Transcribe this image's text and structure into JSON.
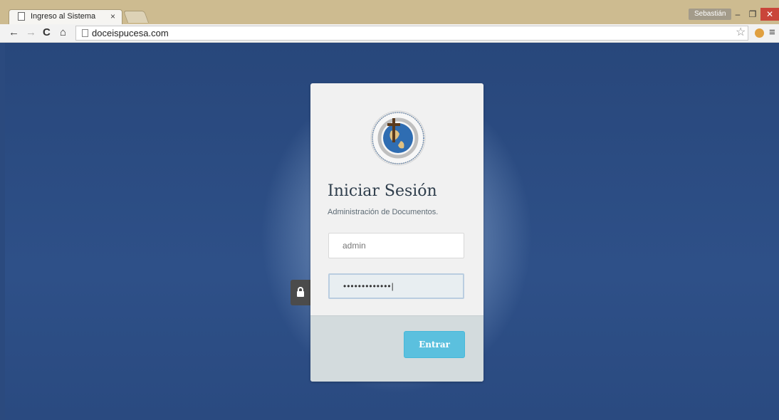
{
  "browser": {
    "tab_title": "Ingreso al Sistema",
    "tab_close": "×",
    "profile_name": "Sebastián",
    "window": {
      "minimize": "–",
      "maximize": "❐",
      "close": "✕"
    },
    "nav": {
      "back": "←",
      "forward": "→",
      "reload": "C",
      "home": "⌂"
    },
    "url": "doceispucesa.com",
    "star": "☆",
    "menu": "≡"
  },
  "login": {
    "title": "Iniciar Sesión",
    "subtitle": "Administración de Documentos.",
    "username_value": "admin",
    "password_value": "•••••••••••••|",
    "submit_label": "Entrar",
    "lock_icon": "lock-icon",
    "logo_icon": "university-seal-logo"
  },
  "colors": {
    "page_bg": "#2b4a7e",
    "button_bg": "#5bc0de",
    "footer_bg": "#d3dbdd",
    "card_bg": "#f1f1f1"
  }
}
